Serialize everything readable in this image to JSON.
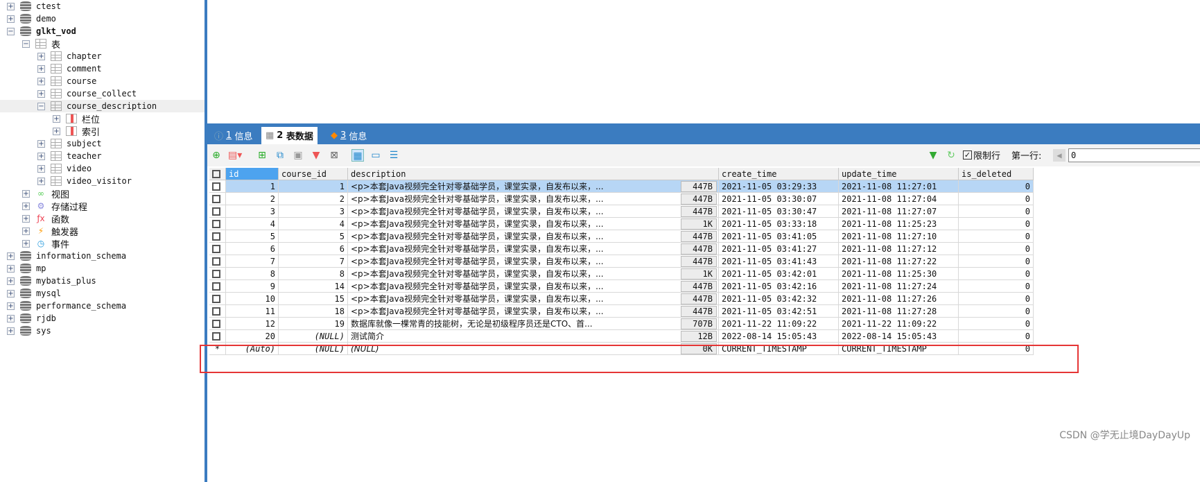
{
  "sidebar": {
    "nodes": [
      {
        "label": "ctest",
        "type": "db",
        "lvl": 0,
        "exp": "+"
      },
      {
        "label": "demo",
        "type": "db",
        "lvl": 0,
        "exp": "+"
      },
      {
        "label": "glkt_vod",
        "type": "db",
        "lvl": 0,
        "exp": "-",
        "bold": true
      },
      {
        "label": "表",
        "type": "tables",
        "lvl": 1,
        "exp": "-"
      },
      {
        "label": "chapter",
        "type": "table",
        "lvl": 2,
        "exp": "+"
      },
      {
        "label": "comment",
        "type": "table",
        "lvl": 2,
        "exp": "+"
      },
      {
        "label": "course",
        "type": "table",
        "lvl": 2,
        "exp": "+"
      },
      {
        "label": "course_collect",
        "type": "table",
        "lvl": 2,
        "exp": "+"
      },
      {
        "label": "course_description",
        "type": "table",
        "lvl": 2,
        "exp": "-",
        "selected": true
      },
      {
        "label": "栏位",
        "type": "cols",
        "lvl": 3,
        "exp": "+"
      },
      {
        "label": "索引",
        "type": "cols",
        "lvl": 3,
        "exp": "+"
      },
      {
        "label": "subject",
        "type": "table",
        "lvl": 2,
        "exp": "+"
      },
      {
        "label": "teacher",
        "type": "table",
        "lvl": 2,
        "exp": "+"
      },
      {
        "label": "video",
        "type": "table",
        "lvl": 2,
        "exp": "+"
      },
      {
        "label": "video_visitor",
        "type": "table",
        "lvl": 2,
        "exp": "+"
      },
      {
        "label": "视图",
        "type": "views",
        "lvl": 1,
        "exp": "+"
      },
      {
        "label": "存储过程",
        "type": "procs",
        "lvl": 1,
        "exp": "+"
      },
      {
        "label": "函数",
        "type": "funcs",
        "lvl": 1,
        "exp": "+"
      },
      {
        "label": "触发器",
        "type": "triggers",
        "lvl": 1,
        "exp": "+"
      },
      {
        "label": "事件",
        "type": "events",
        "lvl": 1,
        "exp": "+"
      },
      {
        "label": "information_schema",
        "type": "db",
        "lvl": 0,
        "exp": "+"
      },
      {
        "label": "mp",
        "type": "db",
        "lvl": 0,
        "exp": "+"
      },
      {
        "label": "mybatis_plus",
        "type": "db",
        "lvl": 0,
        "exp": "+"
      },
      {
        "label": "mysql",
        "type": "db",
        "lvl": 0,
        "exp": "+"
      },
      {
        "label": "performance_schema",
        "type": "db",
        "lvl": 0,
        "exp": "+"
      },
      {
        "label": "rjdb",
        "type": "db",
        "lvl": 0,
        "exp": "+"
      },
      {
        "label": "sys",
        "type": "db",
        "lvl": 0,
        "exp": "+"
      }
    ]
  },
  "tabs": [
    {
      "num": "1",
      "label": "信息",
      "icon": "info-icon"
    },
    {
      "num": "2",
      "label": "表数据",
      "icon": "table-icon",
      "active": true
    },
    {
      "num": "3",
      "label": "信息",
      "icon": "shapes-icon"
    }
  ],
  "toolbar": {
    "limit_rows_label": "限制行",
    "first_row_label": "第一行:",
    "first_row_value": "0",
    "limit_checked": true
  },
  "table": {
    "columns": [
      "id",
      "course_id",
      "description",
      "create_time",
      "update_time",
      "is_deleted"
    ],
    "rows": [
      [
        "1",
        "1",
        "<p>本套Java视频完全针对零基础学员，课堂实录，自发布以来，...",
        "447B",
        "2021-11-05 03:29:33",
        "2021-11-08 11:27:01",
        "0"
      ],
      [
        "2",
        "2",
        "<p>本套Java视频完全针对零基础学员，课堂实录，自发布以来，...",
        "447B",
        "2021-11-05 03:30:07",
        "2021-11-08 11:27:04",
        "0"
      ],
      [
        "3",
        "3",
        "<p>本套Java视频完全针对零基础学员，课堂实录，自发布以来，...",
        "447B",
        "2021-11-05 03:30:47",
        "2021-11-08 11:27:07",
        "0"
      ],
      [
        "4",
        "4",
        "<p>本套Java视频完全针对零基础学员，课堂实录，自发布以来，...",
        "1K",
        "2021-11-05 03:33:18",
        "2021-11-08 11:25:23",
        "0"
      ],
      [
        "5",
        "5",
        "<p>本套Java视频完全针对零基础学员，课堂实录，自发布以来，...",
        "447B",
        "2021-11-05 03:41:05",
        "2021-11-08 11:27:10",
        "0"
      ],
      [
        "6",
        "6",
        "<p>本套Java视频完全针对零基础学员，课堂实录，自发布以来，...",
        "447B",
        "2021-11-05 03:41:27",
        "2021-11-08 11:27:12",
        "0"
      ],
      [
        "7",
        "7",
        "<p>本套Java视频完全针对零基础学员，课堂实录，自发布以来，...",
        "447B",
        "2021-11-05 03:41:43",
        "2021-11-08 11:27:22",
        "0"
      ],
      [
        "8",
        "8",
        "<p>本套Java视频完全针对零基础学员，课堂实录，自发布以来，...",
        "1K",
        "2021-11-05 03:42:01",
        "2021-11-08 11:25:30",
        "0"
      ],
      [
        "9",
        "14",
        "<p>本套Java视频完全针对零基础学员，课堂实录，自发布以来，...",
        "447B",
        "2021-11-05 03:42:16",
        "2021-11-08 11:27:24",
        "0"
      ],
      [
        "10",
        "15",
        "<p>本套Java视频完全针对零基础学员，课堂实录，自发布以来，...",
        "447B",
        "2021-11-05 03:42:32",
        "2021-11-08 11:27:26",
        "0"
      ],
      [
        "11",
        "18",
        "<p>本套Java视频完全针对零基础学员，课堂实录，自发布以来，...",
        "447B",
        "2021-11-05 03:42:51",
        "2021-11-08 11:27:28",
        "0"
      ],
      [
        "12",
        "19",
        "数据库就像一棵常青的技能树，无论是初级程序员还是CTO、首...",
        "707B",
        "2021-11-22 11:09:22",
        "2021-11-22 11:09:22",
        "0"
      ],
      [
        "20",
        "(NULL)",
        "测试简介",
        "12B",
        "2022-08-14 15:05:43",
        "2022-08-14 15:05:43",
        "0"
      ],
      [
        "(Auto)",
        "(NULL)",
        "(NULL)",
        "0K",
        "CURRENT_TIMESTAMP",
        "CURRENT_TIMESTAMP",
        "0"
      ]
    ],
    "selected_row": 0,
    "highlighted_row": 12
  },
  "colors": {
    "accent": "#3b7cc0",
    "selection": "#b7d6f5",
    "header_selected": "#4da3ef",
    "highlight_box": "#e53535"
  },
  "watermark": "CSDN @学无止境DayDayUp"
}
